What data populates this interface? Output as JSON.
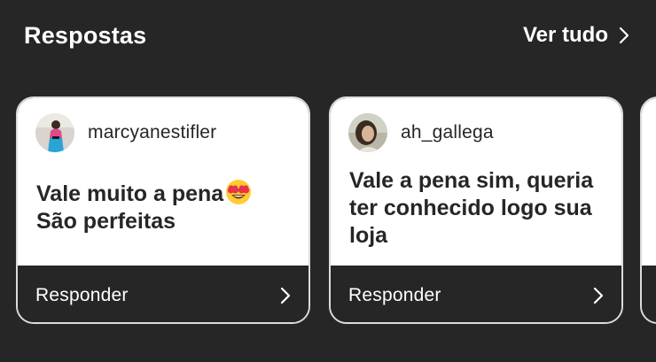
{
  "header": {
    "title": "Respostas",
    "see_all_label": "Ver tudo",
    "see_all_icon": "chevron-right-icon"
  },
  "cards": [
    {
      "username": "marcyanestifler",
      "message_lines": [
        "Vale muito a pena",
        "São perfeitas"
      ],
      "emoji": "heart-eyes-emoji",
      "reply_label": "Responder",
      "reply_icon": "chevron-right-icon"
    },
    {
      "username": "ah_gallega",
      "message_lines": [
        "Vale a pena sim, queria",
        "ter conhecido logo sua",
        "loja"
      ],
      "reply_label": "Responder",
      "reply_icon": "chevron-right-icon"
    }
  ],
  "colors": {
    "background": "#262626",
    "card_body": "#ffffff",
    "card_border": "#dcdcdc",
    "text_dark": "#262626",
    "text_light": "#ffffff"
  }
}
